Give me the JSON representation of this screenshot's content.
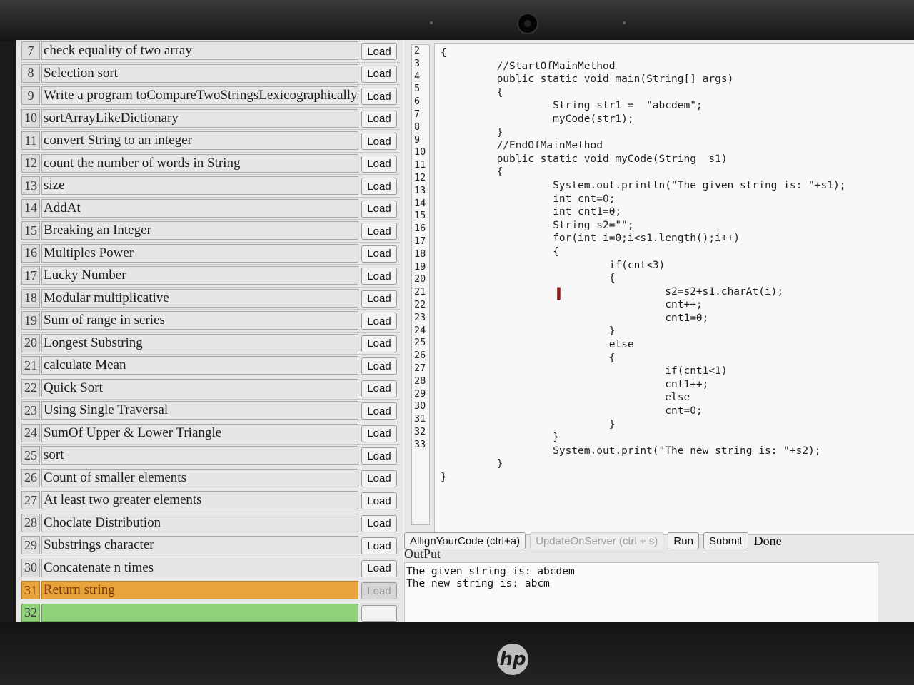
{
  "problems": [
    {
      "num": "7",
      "title": "check equality of two array",
      "load": "Load"
    },
    {
      "num": "8",
      "title": "Selection sort",
      "load": "Load"
    },
    {
      "num": "9",
      "title": "Write a program toCompareTwoStringsLexicographically.",
      "load": "Load"
    },
    {
      "num": "10",
      "title": "sortArrayLikeDictionary",
      "load": "Load"
    },
    {
      "num": "11",
      "title": "convert String to an integer",
      "load": "Load"
    },
    {
      "num": "12",
      "title": "count the number of words in String",
      "load": "Load"
    },
    {
      "num": "13",
      "title": "size",
      "load": "Load"
    },
    {
      "num": "14",
      "title": "AddAt",
      "load": "Load"
    },
    {
      "num": "15",
      "title": "Breaking an Integer",
      "load": "Load"
    },
    {
      "num": "16",
      "title": "Multiples Power",
      "load": "Load"
    },
    {
      "num": "17",
      "title": "Lucky Number",
      "load": "Load"
    },
    {
      "num": "18",
      "title": "Modular multiplicative",
      "load": "Load"
    },
    {
      "num": "19",
      "title": "Sum of range in series",
      "load": "Load"
    },
    {
      "num": "20",
      "title": "Longest Substring",
      "load": "Load"
    },
    {
      "num": "21",
      "title": "calculate Mean",
      "load": "Load"
    },
    {
      "num": "22",
      "title": "Quick Sort",
      "load": "Load"
    },
    {
      "num": "23",
      "title": "Using Single Traversal",
      "load": "Load"
    },
    {
      "num": "24",
      "title": "SumOf Upper & Lower Triangle",
      "load": "Load"
    },
    {
      "num": "25",
      "title": "sort",
      "load": "Load"
    },
    {
      "num": "26",
      "title": "Count of smaller elements",
      "load": "Load"
    },
    {
      "num": "27",
      "title": "At least two greater elements",
      "load": "Load"
    },
    {
      "num": "28",
      "title": "Choclate Distribution",
      "load": "Load"
    },
    {
      "num": "29",
      "title": "Substrings character",
      "load": "Load"
    },
    {
      "num": "30",
      "title": "Concatenate n times",
      "load": "Load"
    },
    {
      "num": "31",
      "title": "Return string",
      "load": "Load"
    },
    {
      "num": "32",
      "title": "",
      "load": ""
    }
  ],
  "colors": {
    "active_row": "#e8a33a",
    "next_row": "#8fd07a",
    "cursor": "#8b1a1a"
  },
  "gutter_lines": [
    "2",
    "3",
    "4",
    "5",
    "6",
    "7",
    "8",
    "9",
    "10",
    "11",
    "12",
    "13",
    "14",
    "15",
    "16",
    "17",
    "18",
    "19",
    "20",
    "21",
    "22",
    "23",
    "24",
    "25",
    "26",
    "27",
    "28",
    "29",
    "30",
    "31",
    "32",
    "33"
  ],
  "code": "{\n         //StartOfMainMethod\n         public static void main(String[] args)\n         {\n                  String str1 =  \"abcdem\";\n                  myCode(str1);\n         }\n         //EndOfMainMethod\n         public static void myCode(String  s1)\n         {\n                  System.out.println(\"The given string is: \"+s1);\n                  int cnt=0;\n                  int cnt1=0;\n                  String s2=\"\";\n                  for(int i=0;i<s1.length();i++)\n                  {\n                           if(cnt<3)\n                           {\n                                    s2=s2+s1.charAt(i);\n                                    cnt++;\n                                    cnt1=0;\n                           }\n                           else\n                           {\n                                    if(cnt1<1)\n                                    cnt1++;\n                                    else\n                                    cnt=0;\n                           }\n                  }\n                  System.out.print(\"The new string is: \"+s2);\n         }\n}",
  "toolbar": {
    "align": "AllignYourCode (ctrl+a)",
    "update": "UpdateOnServer (ctrl + s)",
    "run": "Run",
    "submit": "Submit",
    "status": "Done"
  },
  "output": {
    "label": "OutPut",
    "line1": "The given string is: abcdem",
    "line2": "The new string is: abcm"
  },
  "logo_text": "hp"
}
